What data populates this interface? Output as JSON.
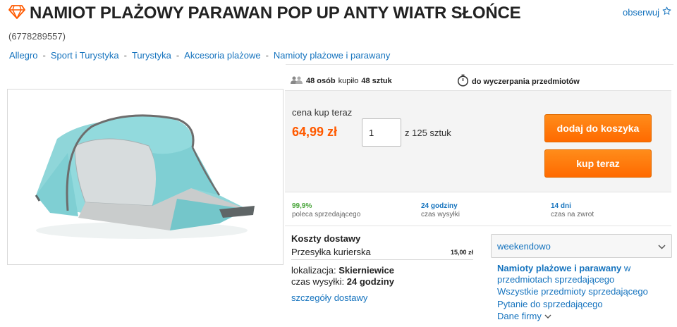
{
  "header": {
    "title": "NAMIOT PLAŻOWY PARAWAN POP UP ANTY WIATR SŁOŃCE",
    "item_id": "(6778289557)",
    "watch_label": "obserwuj",
    "brand_icon": "diamond-icon",
    "watch_icon": "star-outline-icon"
  },
  "breadcrumbs": [
    "Allegro",
    "Sport i Turystyka",
    "Turystyka",
    "Akcesoria plażowe",
    "Namioty plażowe i parawany"
  ],
  "stats": {
    "buyers_count": "48 osób",
    "bought_text": "kupiło",
    "units": "48 sztuk",
    "stock_text": "do wyczerpania przedmiotów"
  },
  "purchase": {
    "price_label": "cena kup teraz",
    "price": "64,99 zł",
    "quantity_value": "1",
    "quantity_of": "z 125 sztuk",
    "add_to_cart_label": "dodaj do koszyka",
    "buy_now_label": "kup teraz"
  },
  "metrics": [
    {
      "value": "99,9%",
      "label": "poleca sprzedającego"
    },
    {
      "value": "24 godziny",
      "label": "czas wysyłki"
    },
    {
      "value": "14 dni",
      "label": "czas na zwrot"
    }
  ],
  "delivery": {
    "title": "Koszty dostawy",
    "method": "Przesyłka kurierska",
    "method_price": "15,00 zł",
    "location_label": "lokalizacja:",
    "location_value": "Skierniewice",
    "shipping_label": "czas wysyłki:",
    "shipping_value": "24 godziny",
    "details_link": "szczegóły dostawy"
  },
  "seller": {
    "name": "weekendowo",
    "category_link": "Namioty plażowe i parawany",
    "category_suffix_1": "w",
    "category_suffix_2": "przedmiotach sprzedającego",
    "all_items": "Wszystkie przedmioty sprzedającego",
    "question": "Pytanie do sprzedającego",
    "company": "Dane firmy"
  },
  "colors": {
    "accent_orange": "#ff6a00",
    "price_orange": "#ff5a00",
    "link_blue": "#1573be",
    "recommend_green": "#49a53b",
    "tent_teal": "#7fcfd3"
  }
}
